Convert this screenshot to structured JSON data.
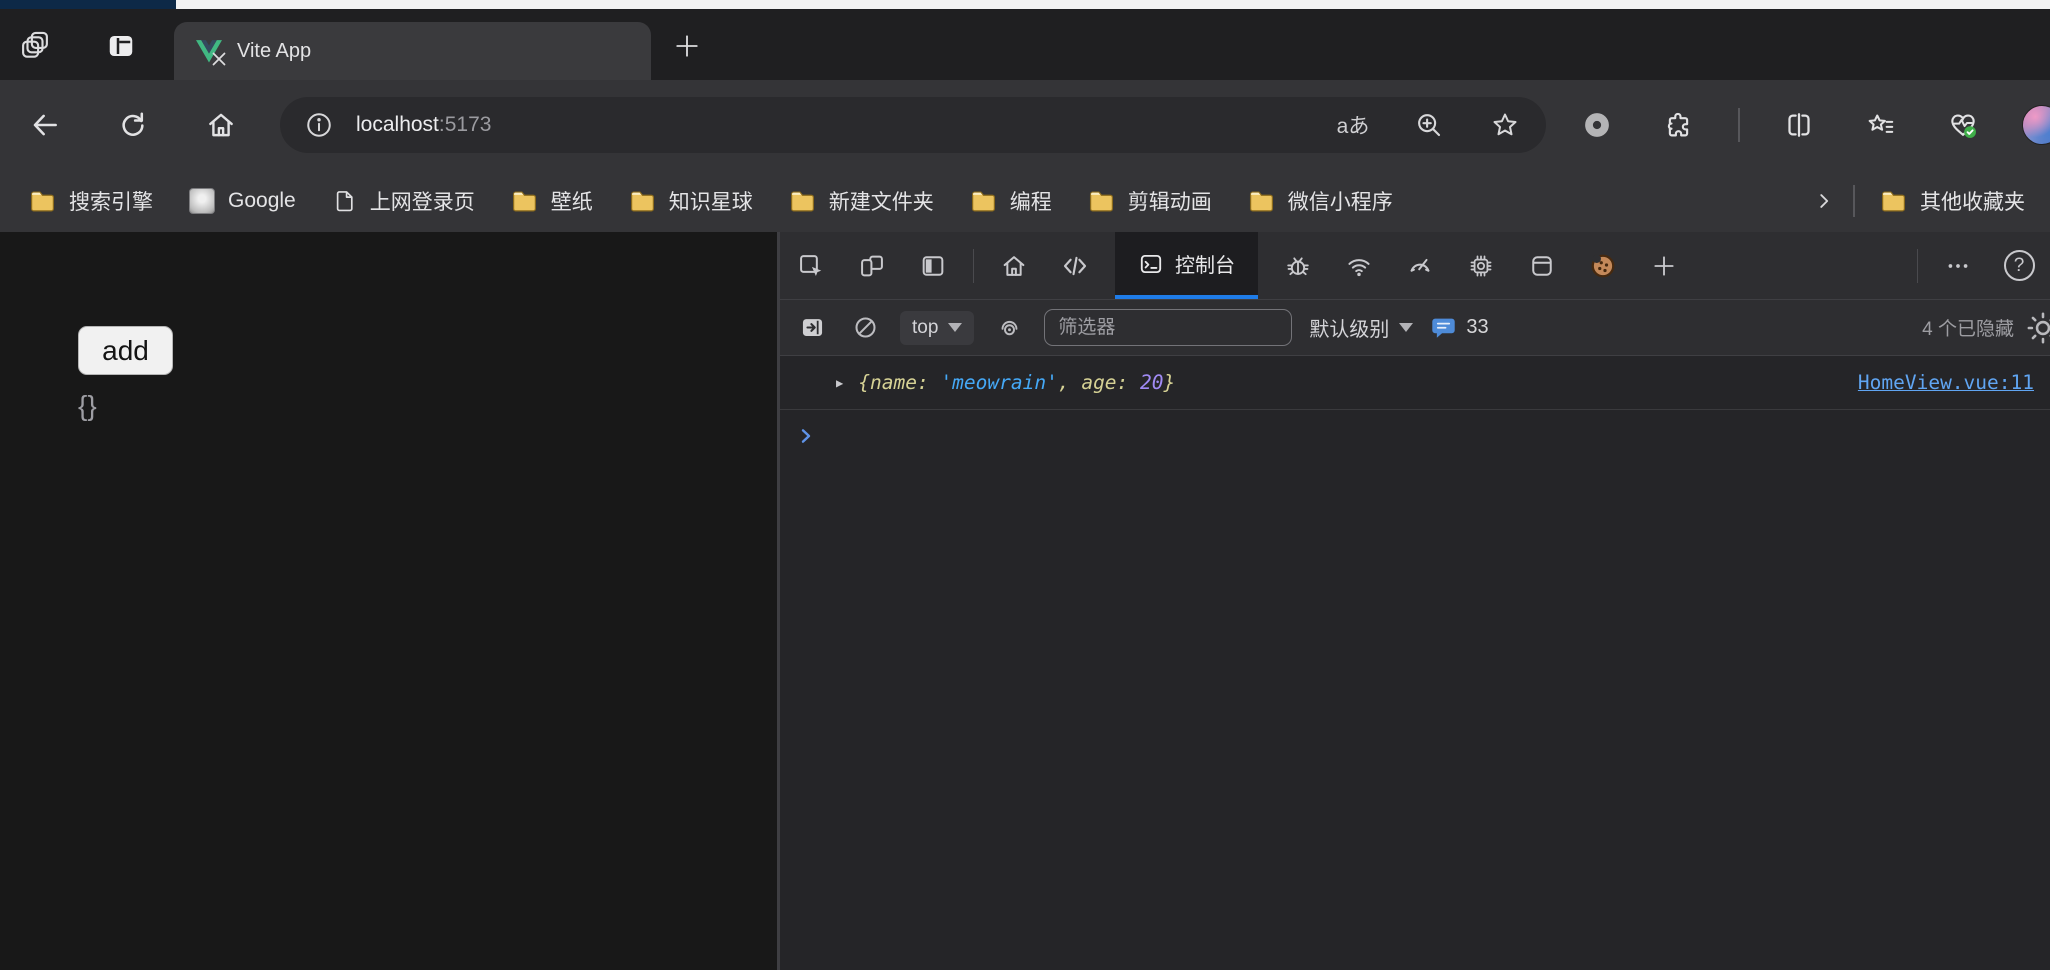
{
  "browser": {
    "tab_title": "Vite App",
    "url_host": "localhost",
    "url_port": ":5173",
    "translate_glyph": "aあ"
  },
  "bookmarks": {
    "items": [
      {
        "label": "搜索引擎",
        "icon": "folder-icon"
      },
      {
        "label": "Google",
        "icon": "google-favicon"
      },
      {
        "label": "上网登录页",
        "icon": "page-icon"
      },
      {
        "label": "壁纸",
        "icon": "folder-icon"
      },
      {
        "label": "知识星球",
        "icon": "folder-icon"
      },
      {
        "label": "新建文件夹",
        "icon": "folder-icon"
      },
      {
        "label": "编程",
        "icon": "folder-icon"
      },
      {
        "label": "剪辑动画",
        "icon": "folder-icon"
      },
      {
        "label": "微信小程序",
        "icon": "folder-icon"
      }
    ],
    "other_favorites_label": "其他收藏夹"
  },
  "devtools": {
    "console_tab_label": "控制台",
    "context_selector_value": "top",
    "filter_placeholder": "筛选器",
    "log_level_label": "默认级别",
    "issues_count": "33",
    "hidden_messages_label": "4 个已隐藏",
    "help_glyph": "?",
    "console_log": {
      "expander_glyph": "▶",
      "brace_open": "{",
      "key_name": "name: ",
      "string_value": "'meowrain'",
      "comma": ", ",
      "key_age": "age: ",
      "number_value": "20",
      "brace_close": "}",
      "source_link": "HomeView.vue:11"
    }
  },
  "page": {
    "add_button_label": "add",
    "object_preview": "{}"
  },
  "colors": {
    "accent_blue": "#1f7ce8",
    "vue_green": "#41b883",
    "folder_yellow": "#ecc45f",
    "link_blue": "#60a5f2",
    "token_key": "#d6d295",
    "token_string": "#45a9f7",
    "token_number": "#a18bf5"
  }
}
